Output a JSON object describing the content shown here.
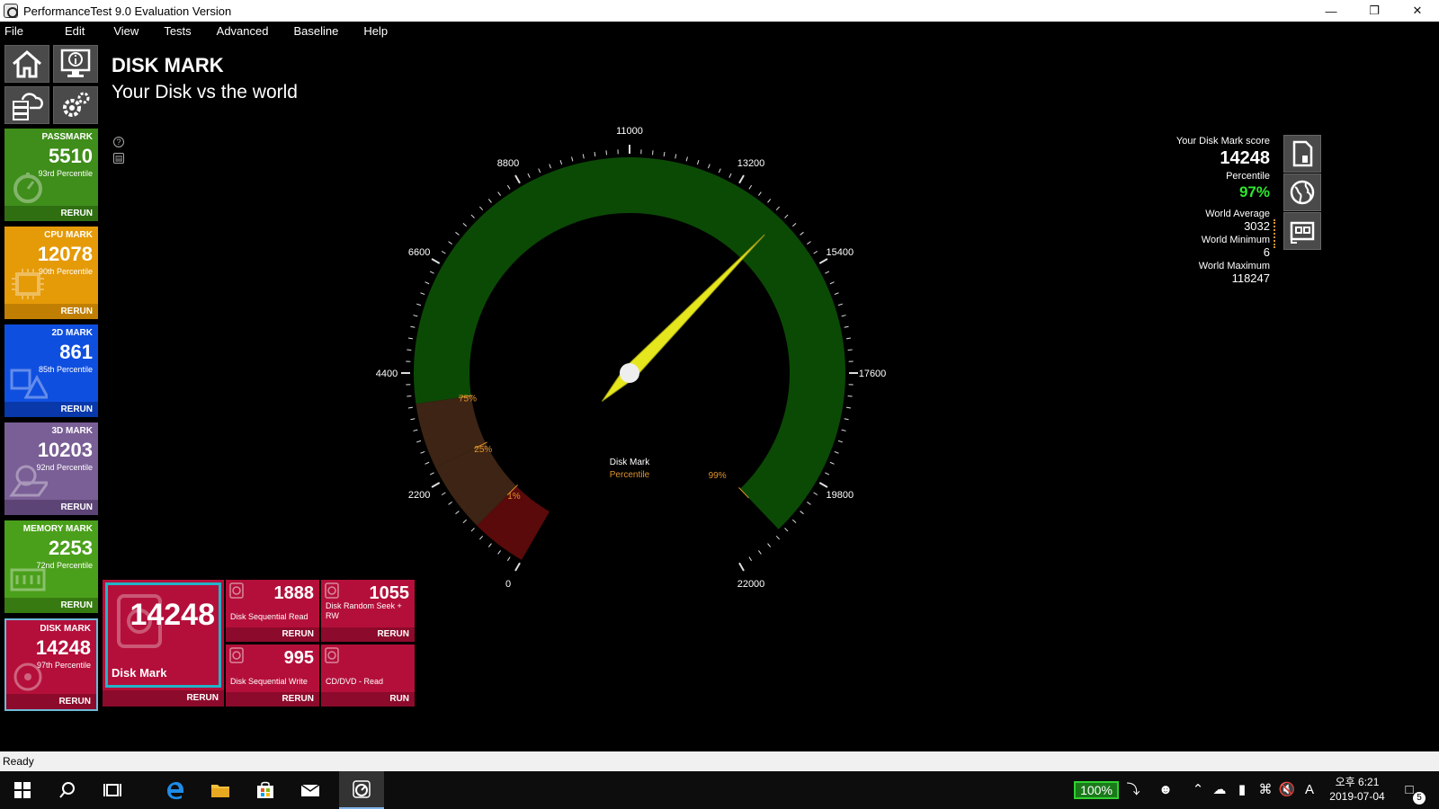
{
  "window": {
    "title": "PerformanceTest 9.0 Evaluation Version"
  },
  "menu": [
    "File",
    "Edit",
    "View",
    "Tests",
    "Advanced",
    "Baseline",
    "Help"
  ],
  "header": {
    "title": "DISK MARK",
    "subtitle": "Your Disk vs the world"
  },
  "tiles": [
    {
      "id": "passmark",
      "name": "PASSMARK",
      "score": "5510",
      "percentile": "93rd Percentile",
      "action": "RERUN",
      "color": "#3f8d1a"
    },
    {
      "id": "cpu",
      "name": "CPU MARK",
      "score": "12078",
      "percentile": "90th Percentile",
      "action": "RERUN",
      "color": "#e59a07"
    },
    {
      "id": "2d",
      "name": "2D MARK",
      "score": "861",
      "percentile": "85th Percentile",
      "action": "RERUN",
      "color": "#0f4fe0"
    },
    {
      "id": "3d",
      "name": "3D MARK",
      "score": "10203",
      "percentile": "92nd Percentile",
      "action": "RERUN",
      "color": "#7a5f96"
    },
    {
      "id": "memory",
      "name": "MEMORY MARK",
      "score": "2253",
      "percentile": "72nd Percentile",
      "action": "RERUN",
      "color": "#4ba01b"
    },
    {
      "id": "disk",
      "name": "DISK MARK",
      "score": "14248",
      "percentile": "97th Percentile",
      "action": "RERUN",
      "color": "#b40f3a"
    }
  ],
  "gauge": {
    "min": 0,
    "max": 22000,
    "value": 14248,
    "tick_labels": [
      "0",
      "2200",
      "4400",
      "6600",
      "8800",
      "11000",
      "13200",
      "15400",
      "17600",
      "19800",
      "22000"
    ],
    "bands": [
      {
        "label": "1%",
        "from": 0,
        "to": 1100,
        "color": "#5a0a0a"
      },
      {
        "label": "25%",
        "from": 1100,
        "to": 2500,
        "color": "#3d2414"
      },
      {
        "label": "75%",
        "from": 2500,
        "to": 3800,
        "color": "#3d2414"
      },
      {
        "label": "99%",
        "from": 3800,
        "to": 21000,
        "color": "#0b4a05"
      }
    ],
    "center_label": "Disk Mark",
    "center_sublabel": "Percentile"
  },
  "score_panel": {
    "score_label": "Your Disk Mark score",
    "score": "14248",
    "percentile_label": "Percentile",
    "percentile": "97%",
    "world_average_label": "World Average",
    "world_average": "3032",
    "world_minimum_label": "World Minimum",
    "world_minimum": "6",
    "world_maximum_label": "World Maximum",
    "world_maximum": "118247"
  },
  "disk_tests": {
    "main": {
      "score": "14248",
      "name": "Disk Mark",
      "action": "RERUN"
    },
    "sub": [
      {
        "score": "1888",
        "name": "Disk Sequential Read",
        "action": "RERUN"
      },
      {
        "score": "1055",
        "name": "Disk Random Seek + RW",
        "action": "RERUN"
      },
      {
        "score": "995",
        "name": "Disk Sequential Write",
        "action": "RERUN"
      },
      {
        "score": "",
        "name": "CD/DVD - Read",
        "action": "RUN"
      }
    ]
  },
  "status": "Ready",
  "taskbar": {
    "battery": "100%",
    "time": "오후 6:21",
    "date": "2019-07-04",
    "notifications": "5",
    "ime": "A"
  },
  "colors": {
    "disk": "#b40f3a",
    "gauge_green": "#0b4a05",
    "needle": "#e6e61e",
    "percentile_text": "#e0932a"
  }
}
